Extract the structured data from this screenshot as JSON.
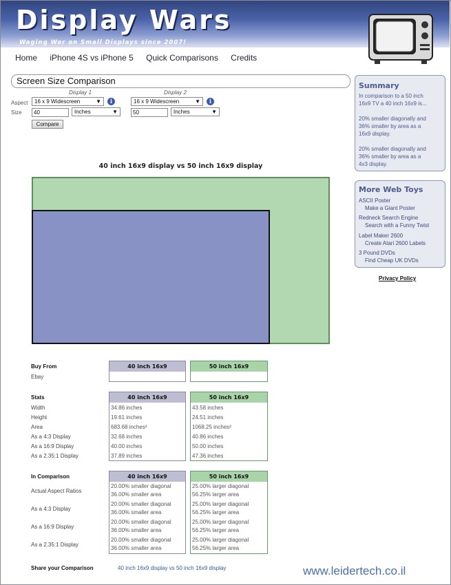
{
  "header": {
    "title": "Display Wars",
    "tagline": "Waging War on Small Displays since 2007!"
  },
  "nav": [
    "Home",
    "iPhone 4S vs iPhone 5",
    "Quick Comparisons",
    "Credits"
  ],
  "section_title": "Screen Size Comparison",
  "form": {
    "display1_label": "Display 1",
    "display2_label": "Display 2",
    "aspect_label": "Aspect",
    "size_label": "Size",
    "d1_aspect": "16 x 9 Widescreen",
    "d2_aspect": "16 x 9 Widescreen",
    "d1_size": "40",
    "d2_size": "50",
    "d1_unit": "Inches",
    "d2_unit": "Inches",
    "arrow": "▼",
    "info": "i",
    "compare": "Compare"
  },
  "comparison_title": "40 inch 16x9 display vs 50 inch 16x9 display",
  "columns": {
    "a": "40 inch 16x9",
    "b": "50 inch 16x9"
  },
  "buy": {
    "label": "Buy From",
    "rows": [
      "Ebay"
    ]
  },
  "stats": {
    "label": "Stats",
    "rows": [
      "Width",
      "Height",
      "Area",
      "As a 4:3 Display",
      "As a 16:9 Display",
      "As a 2.35:1 Display"
    ],
    "a": [
      "34.86 inches",
      "19.61 inches",
      "683.68 inches²",
      "32.68 inches",
      "40.00 inches",
      "37.89 inches"
    ],
    "b": [
      "43.58 inches",
      "24.51 inches",
      "1068.25 inches²",
      "40.86 inches",
      "50.00 inches",
      "47.36 inches"
    ]
  },
  "in_comparison": {
    "label": "In Comparison",
    "rows": [
      "Actual Aspect Ratios",
      "As a 4:3 Display",
      "As a 16:9 Display",
      "As a 2.35:1 Display"
    ],
    "a": [
      [
        "20.00% smaller diagonal",
        "36.00% smaller area"
      ],
      [
        "20.00% smaller diagonal",
        "36.00% smaller area"
      ],
      [
        "20.00% smaller diagonal",
        "36.00% smaller area"
      ],
      [
        "20.00% smaller diagonal",
        "36.00% smaller area"
      ]
    ],
    "b": [
      [
        "25.00% larger diagonal",
        "56.25% larger area"
      ],
      [
        "25.00% larger diagonal",
        "56.25% larger area"
      ],
      [
        "25.00% larger diagonal",
        "56.25% larger area"
      ],
      [
        "25.00% larger diagonal",
        "56.25% larger area"
      ]
    ]
  },
  "share": {
    "label": "Share your Comparison",
    "link": "40 inch 16x9 display vs 50 inch 16x9 display"
  },
  "watermark": "www.leidertech.co.il",
  "summary": {
    "title": "Summary",
    "lines": [
      "In comparison to a 50 inch",
      "16x9 TV a 40 inch 16x9 is...",
      "",
      "20% smaller diagonally and",
      "36% smaller by area as a",
      "16x9 display.",
      "",
      "20% smaller diagonally and",
      "36% smaller by area as a",
      "4x3 display."
    ]
  },
  "toys": {
    "title": "More Web Toys",
    "items": [
      {
        "name": "ASCII Poster",
        "desc": "Make a Giant Poster"
      },
      {
        "name": "Redneck Search Engine",
        "desc": "Search with a Funny Twist"
      },
      {
        "name": "Label Maker 2600",
        "desc": "Create Atari 2600 Labels"
      },
      {
        "name": "3 Pound DVDs",
        "desc": "Find Cheap UK DVDs"
      }
    ]
  },
  "privacy": "Privacy Policy",
  "colors": {
    "display_a": "#8892c4",
    "display_b": "#b1d8b1",
    "accent": "#4d5a8e"
  }
}
